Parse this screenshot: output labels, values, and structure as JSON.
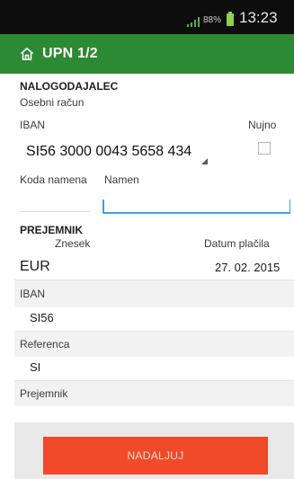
{
  "status": {
    "battery_percent": "88%",
    "time": "13:23"
  },
  "appbar": {
    "title": "UPN 1/2"
  },
  "payer": {
    "section_title": "NALOGODAJALEC",
    "account_label": "Osebni račun",
    "iban_label": "IBAN",
    "iban_value": "SI56 3000 0043 5658 434",
    "urgent_label": "Nujno",
    "purpose_code_label": "Koda namena",
    "purpose_label": "Namen"
  },
  "recipient": {
    "section_title": "PREJEMNIK",
    "amount_label": "Znesek",
    "date_label": "Datum plačila",
    "currency": "EUR",
    "date_value": "27. 02. 2015",
    "iban_label": "IBAN",
    "iban_value": "SI56",
    "reference_label": "Referenca",
    "reference_value": "SI",
    "recipient_label": "Prejemnik"
  },
  "actions": {
    "continue_label": "NADALJUJ"
  },
  "colors": {
    "appbar": "#2b8a33",
    "button": "#f04a2a",
    "input_focus": "#38a6d9"
  }
}
